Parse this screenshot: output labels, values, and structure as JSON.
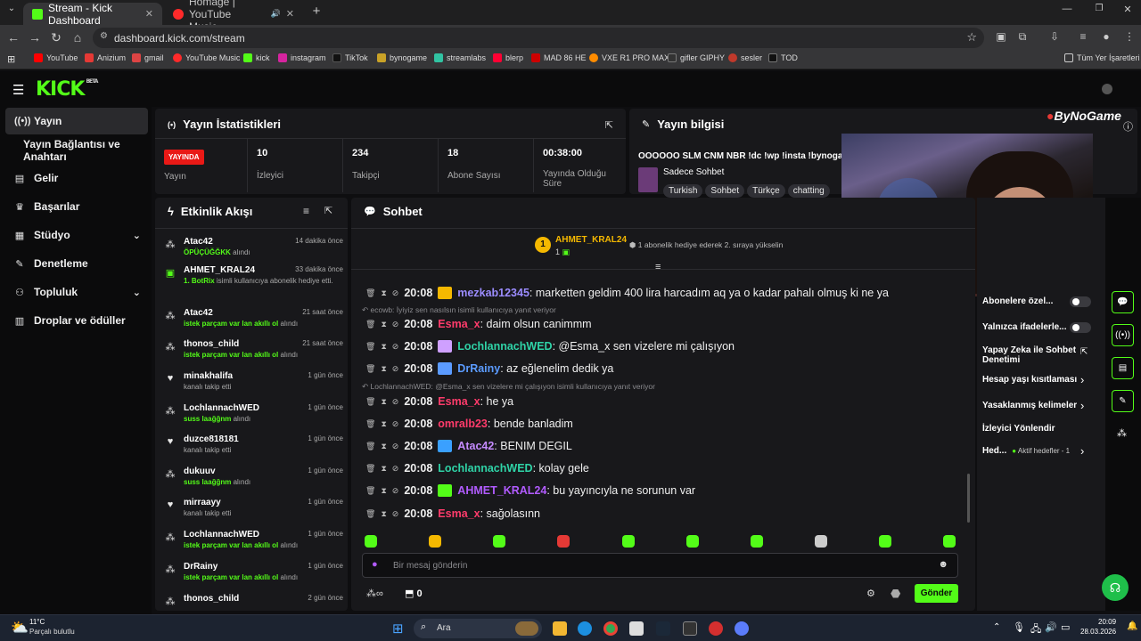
{
  "browser": {
    "tabs": [
      {
        "label": "Stream - Kick Dashboard"
      },
      {
        "label": "Homage | YouTube Music"
      }
    ],
    "new_tab": "+",
    "url": "dashboard.kick.com/stream",
    "bookmarks": [
      "YouTube",
      "Anizium",
      "gmail",
      "YouTube Music",
      "kick",
      "instagram",
      "TikTok",
      "bynogame",
      "streamlabs",
      "blerp",
      "MAD 86 HE",
      "VXE R1 PRO MAX",
      "gifler GIPHY",
      "sesler",
      "TOD"
    ],
    "all_bookmarks": "Tüm Yer İşaretleri"
  },
  "kick": {
    "logo": "KICK",
    "beta": "BETA"
  },
  "sidebar": {
    "items": [
      {
        "label": "Yayın",
        "icon": "broadcast-icon"
      },
      {
        "label": "Yayın Bağlantısı ve Anahtarı",
        "icon": ""
      },
      {
        "label": "Gelir",
        "icon": "chart-icon"
      },
      {
        "label": "Başarılar",
        "icon": "trophy-icon"
      },
      {
        "label": "Stüdyo",
        "icon": "studio-icon"
      },
      {
        "label": "Denetleme",
        "icon": "wrench-icon"
      },
      {
        "label": "Topluluk",
        "icon": "people-icon"
      },
      {
        "label": "Droplar ve ödüller",
        "icon": "gift-icon"
      }
    ]
  },
  "stats": {
    "title": "Yayın İstatistikleri",
    "live_badge": "YAYINDA",
    "live_label": "Yayın",
    "cells": [
      {
        "value": "10",
        "label": "İzleyici"
      },
      {
        "value": "234",
        "label": "Takipçi"
      },
      {
        "value": "18",
        "label": "Abone Sayısı"
      },
      {
        "value": "00:38:00",
        "label": "Yayında Olduğu Süre"
      }
    ]
  },
  "info": {
    "title": "Yayın bilgisi",
    "stream_title": "OOOOOO SLM CNM NBR !dc !wp !insta !bynogame",
    "category": "Sadece Sohbet",
    "tags": [
      "Turkish",
      "Sohbet",
      "Türkçe",
      "chatting"
    ],
    "watermark": "ByNoGame"
  },
  "activity": {
    "title": "Etkinlik Akışı",
    "items": [
      {
        "name": "Atac42",
        "time": "14 dakika önce",
        "green": "ÖPÜÇÜĞĞKK",
        "rest": " alındı",
        "icon": "gift-icon"
      },
      {
        "name": "AHMET_KRAL24",
        "time": "33 dakika önce",
        "green": "1. BotRix",
        "rest": " isimli kullanıcıya abonelik hediye etti.",
        "icon": "sub-gift-icon"
      },
      {
        "name": "Atac42",
        "time": "21 saat önce",
        "green": "istek parçam var lan akıllı ol",
        "rest": " alındı",
        "icon": "gift-icon"
      },
      {
        "name": "thonos_child",
        "time": "21 saat önce",
        "green": "istek parçam var lan akıllı ol",
        "rest": " alındı",
        "icon": "gift-icon"
      },
      {
        "name": "minakhalifa",
        "time": "1 gün önce",
        "green": "",
        "rest": "kanalı takip etti",
        "icon": "heart-icon"
      },
      {
        "name": "LochlannachWED",
        "time": "1 gün önce",
        "green": "suss laağğnm",
        "rest": " alındı",
        "icon": "gift-icon"
      },
      {
        "name": "duzce818181",
        "time": "1 gün önce",
        "green": "",
        "rest": "kanalı takip etti",
        "icon": "heart-icon"
      },
      {
        "name": "dukuuv",
        "time": "1 gün önce",
        "green": "suss laağğnm",
        "rest": " alındı",
        "icon": "gift-icon"
      },
      {
        "name": "mirraayy",
        "time": "1 gün önce",
        "green": "",
        "rest": "kanalı takip etti",
        "icon": "heart-icon"
      },
      {
        "name": "LochlannachWED",
        "time": "1 gün önce",
        "green": "istek parçam var lan akıllı ol",
        "rest": " alındı",
        "icon": "gift-icon"
      },
      {
        "name": "DrRainy",
        "time": "1 gün önce",
        "green": "istek parçam var lan akıllı ol",
        "rest": " alındı",
        "icon": "gift-icon"
      },
      {
        "name": "thonos_child",
        "time": "2 gün önce",
        "green": "",
        "rest": "",
        "icon": "gift-icon"
      }
    ]
  },
  "chat": {
    "title": "Sohbet",
    "pinned_user": "AHMET_KRAL24",
    "pinned_rank": "1",
    "pinned_count": "1",
    "pinned_hint": "1 abonelik hediye ederek 2. sıraya yükselin",
    "messages": [
      {
        "time": "20:08",
        "user": "mezkab12345",
        "color": "#9b8cff",
        "text": ": marketten geldim 400 lira harcadım aq ya o kadar pahalı olmuş ki ne ya",
        "reply": ""
      },
      {
        "time": "20:08",
        "user": "Esma_x",
        "color": "#ff3b6b",
        "text": ": daim olsun canimmm",
        "reply": "ecowb: İyiyiz sen nasılsın isimli kullanıcıya yanıt veriyor"
      },
      {
        "time": "20:08",
        "user": "LochlannachWED",
        "color": "#2fd3a7",
        "text": ": @Esma_x sen vizelere mi çalışıyon",
        "reply": ""
      },
      {
        "time": "20:08",
        "user": "DrRainy",
        "color": "#5b9bff",
        "text": ": az eğlenelim dedik ya",
        "reply": ""
      },
      {
        "time": "20:08",
        "user": "Esma_x",
        "color": "#ff3b6b",
        "text": ": he ya",
        "reply": "LochlannachWED: @Esma_x sen vizelere mi çalışıyon isimli kullanıcıya yanıt veriyor"
      },
      {
        "time": "20:08",
        "user": "omralb23",
        "color": "#ff3b6b",
        "text": ": bende banladim",
        "reply": ""
      },
      {
        "time": "20:08",
        "user": "Atac42",
        "color": "#c58bff",
        "text": ": BENIM DEGIL",
        "reply": ""
      },
      {
        "time": "20:08",
        "user": "LochlannachWED",
        "color": "#2fd3a7",
        "text": ": kolay gele",
        "reply": ""
      },
      {
        "time": "20:08",
        "user": "AHMET_KRAL24",
        "color": "#b15bff",
        "text": ": bu yayıncıyla ne sorunun var",
        "reply": ""
      },
      {
        "time": "20:08",
        "user": "Esma_x",
        "color": "#ff3b6b",
        "text": ": sağolasınn",
        "reply": ""
      }
    ],
    "input_placeholder": "Bir mesaj gönderin",
    "points": "0",
    "send_label": "Gönder"
  },
  "moderation": {
    "rows": [
      {
        "label": "Abonelere özel...",
        "type": "toggle"
      },
      {
        "label": "Yalnızca ifadelerle...",
        "type": "toggle"
      },
      {
        "label": "Yapay Zeka ile Sohbet Denetimi",
        "type": "external"
      },
      {
        "label": "Hesap yaşı kısıtlaması",
        "type": "arrow"
      },
      {
        "label": "Yasaklanmış kelimeler",
        "type": "arrow"
      },
      {
        "label": "İzleyici Yönlendir",
        "type": "none"
      },
      {
        "label": "Hed...",
        "type": "arrow",
        "extra": "Aktif hedefler - 1"
      }
    ]
  },
  "taskbar": {
    "weather_temp": "11°C",
    "weather_desc": "Parçalı bulutlu",
    "search": "Ara",
    "time": "20:09",
    "date": "28.03.2026"
  }
}
